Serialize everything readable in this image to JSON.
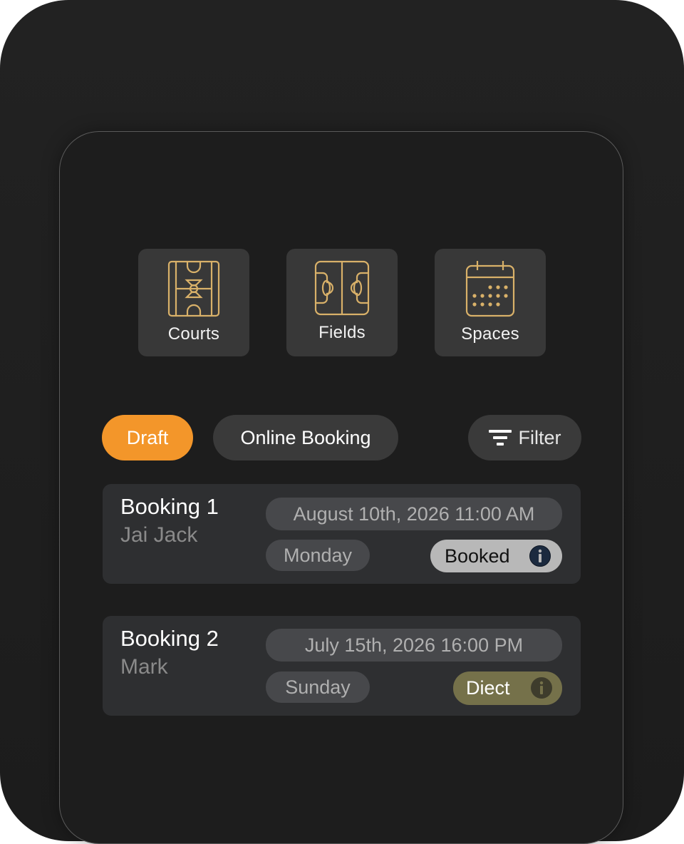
{
  "categories": [
    {
      "label": "Courts",
      "icon": "court-icon"
    },
    {
      "label": "Fields",
      "icon": "field-icon"
    },
    {
      "label": "Spaces",
      "icon": "calendar-icon"
    }
  ],
  "tabs": {
    "draft": "Draft",
    "online": "Online Booking",
    "filter": "Filter"
  },
  "bookings": [
    {
      "title": "Booking 1",
      "name": "Jai Jack",
      "datetime": "August 10th, 2026 11:00 AM",
      "day": "Monday",
      "status": "Booked"
    },
    {
      "title": "Booking 2",
      "name": "Mark",
      "datetime": "July 15th, 2026 16:00 PM",
      "day": "Sunday",
      "status": "Diect"
    }
  ],
  "colors": {
    "accent": "#f3962a",
    "icon_gold": "#d9b169",
    "booked_bg": "#b8b8b8",
    "direct_bg": "#75714a"
  }
}
